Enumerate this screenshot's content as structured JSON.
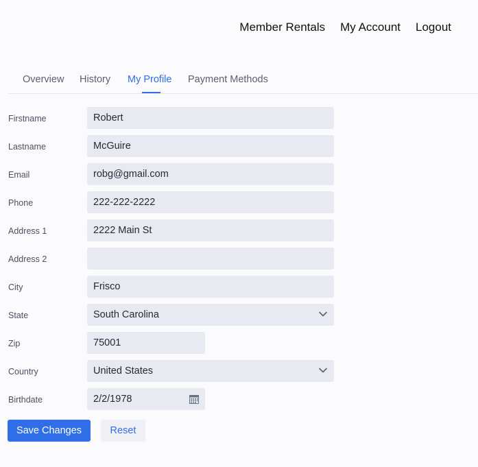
{
  "topnav": {
    "member_rentals": "Member Rentals",
    "my_account": "My Account",
    "logout": "Logout"
  },
  "tabs": [
    {
      "label": "Overview",
      "active": false
    },
    {
      "label": "History",
      "active": false
    },
    {
      "label": "My Profile",
      "active": true
    },
    {
      "label": "Payment Methods",
      "active": false
    }
  ],
  "form": {
    "firstname": {
      "label": "Firstname",
      "value": "Robert"
    },
    "lastname": {
      "label": "Lastname",
      "value": "McGuire"
    },
    "email": {
      "label": "Email",
      "value": "robg@gmail.com"
    },
    "phone": {
      "label": "Phone",
      "value": "222-222-2222"
    },
    "address1": {
      "label": "Address 1",
      "value": "2222 Main St"
    },
    "address2": {
      "label": "Address 2",
      "value": ""
    },
    "city": {
      "label": "City",
      "value": "Frisco"
    },
    "state": {
      "label": "State",
      "value": "South Carolina",
      "icon": "chevron-down-icon"
    },
    "zip": {
      "label": "Zip",
      "value": "75001"
    },
    "country": {
      "label": "Country",
      "value": "United States",
      "icon": "chevron-down-icon"
    },
    "birthdate": {
      "label": "Birthdate",
      "value": "2/2/1978",
      "icon": "calendar-icon"
    }
  },
  "actions": {
    "save_label": "Save Changes",
    "reset_label": "Reset"
  },
  "colors": {
    "accent": "#2f6ee6",
    "field_bg": "#e8eaf1",
    "page_bg": "#fbfbfd"
  }
}
